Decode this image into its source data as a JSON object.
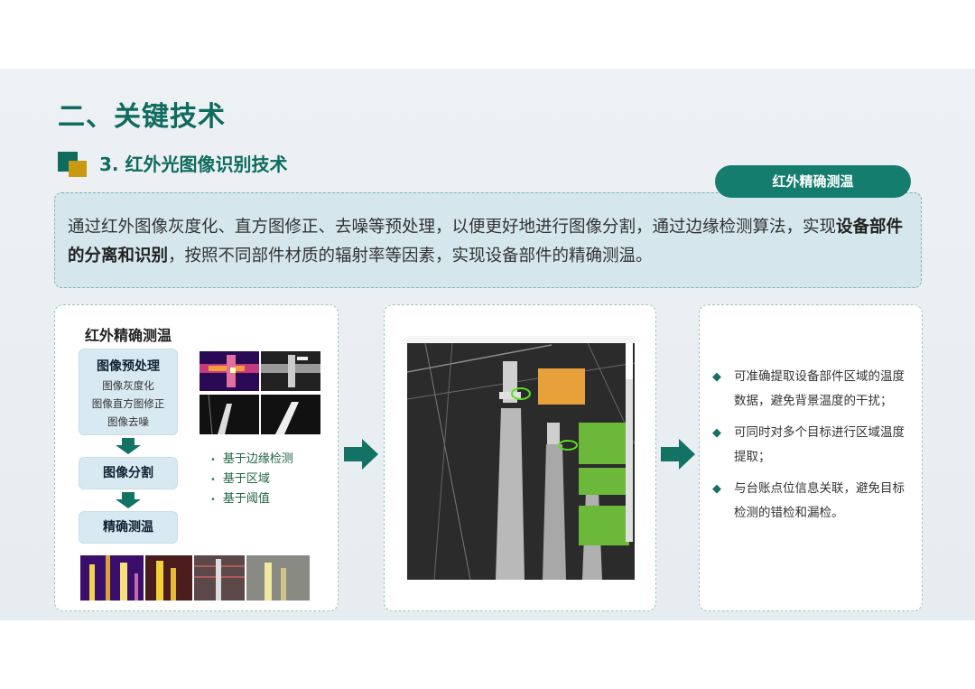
{
  "heading": {
    "main": "二、关键技术",
    "sub": "3. 红外光图像识别技术"
  },
  "pill": {
    "label": "红外精确测温"
  },
  "description": {
    "part1": "通过红外图像灰度化、直方图修正、去噪等预处理，以便更好地进行图像分割，通过边缘检测算法，实现",
    "bold": "设备部件的分离和识别",
    "part2": "，按照不同部件材质的辐射率等因素，实现设备部件的精确测温。"
  },
  "flow_panel": {
    "title": "红外精确测温",
    "step1": {
      "title": "图像预处理",
      "items": [
        "图像灰度化",
        "图像直方图修正",
        "图像去噪"
      ]
    },
    "step2": "图像分割",
    "step3": "精确测温",
    "methods": [
      "基于边缘检测",
      "基于区域",
      "基于阈值"
    ]
  },
  "benefits": [
    "可准确提取设备部件区域的温度数据，避免背景温度的干扰；",
    "可同时对多个目标进行区域温度提取；",
    "与台账点位信息关联，避免目标检测的错检和漏检。"
  ],
  "colors": {
    "primary": "#0e6b5e",
    "accent": "#c79a12",
    "pill": "#157d6d"
  }
}
